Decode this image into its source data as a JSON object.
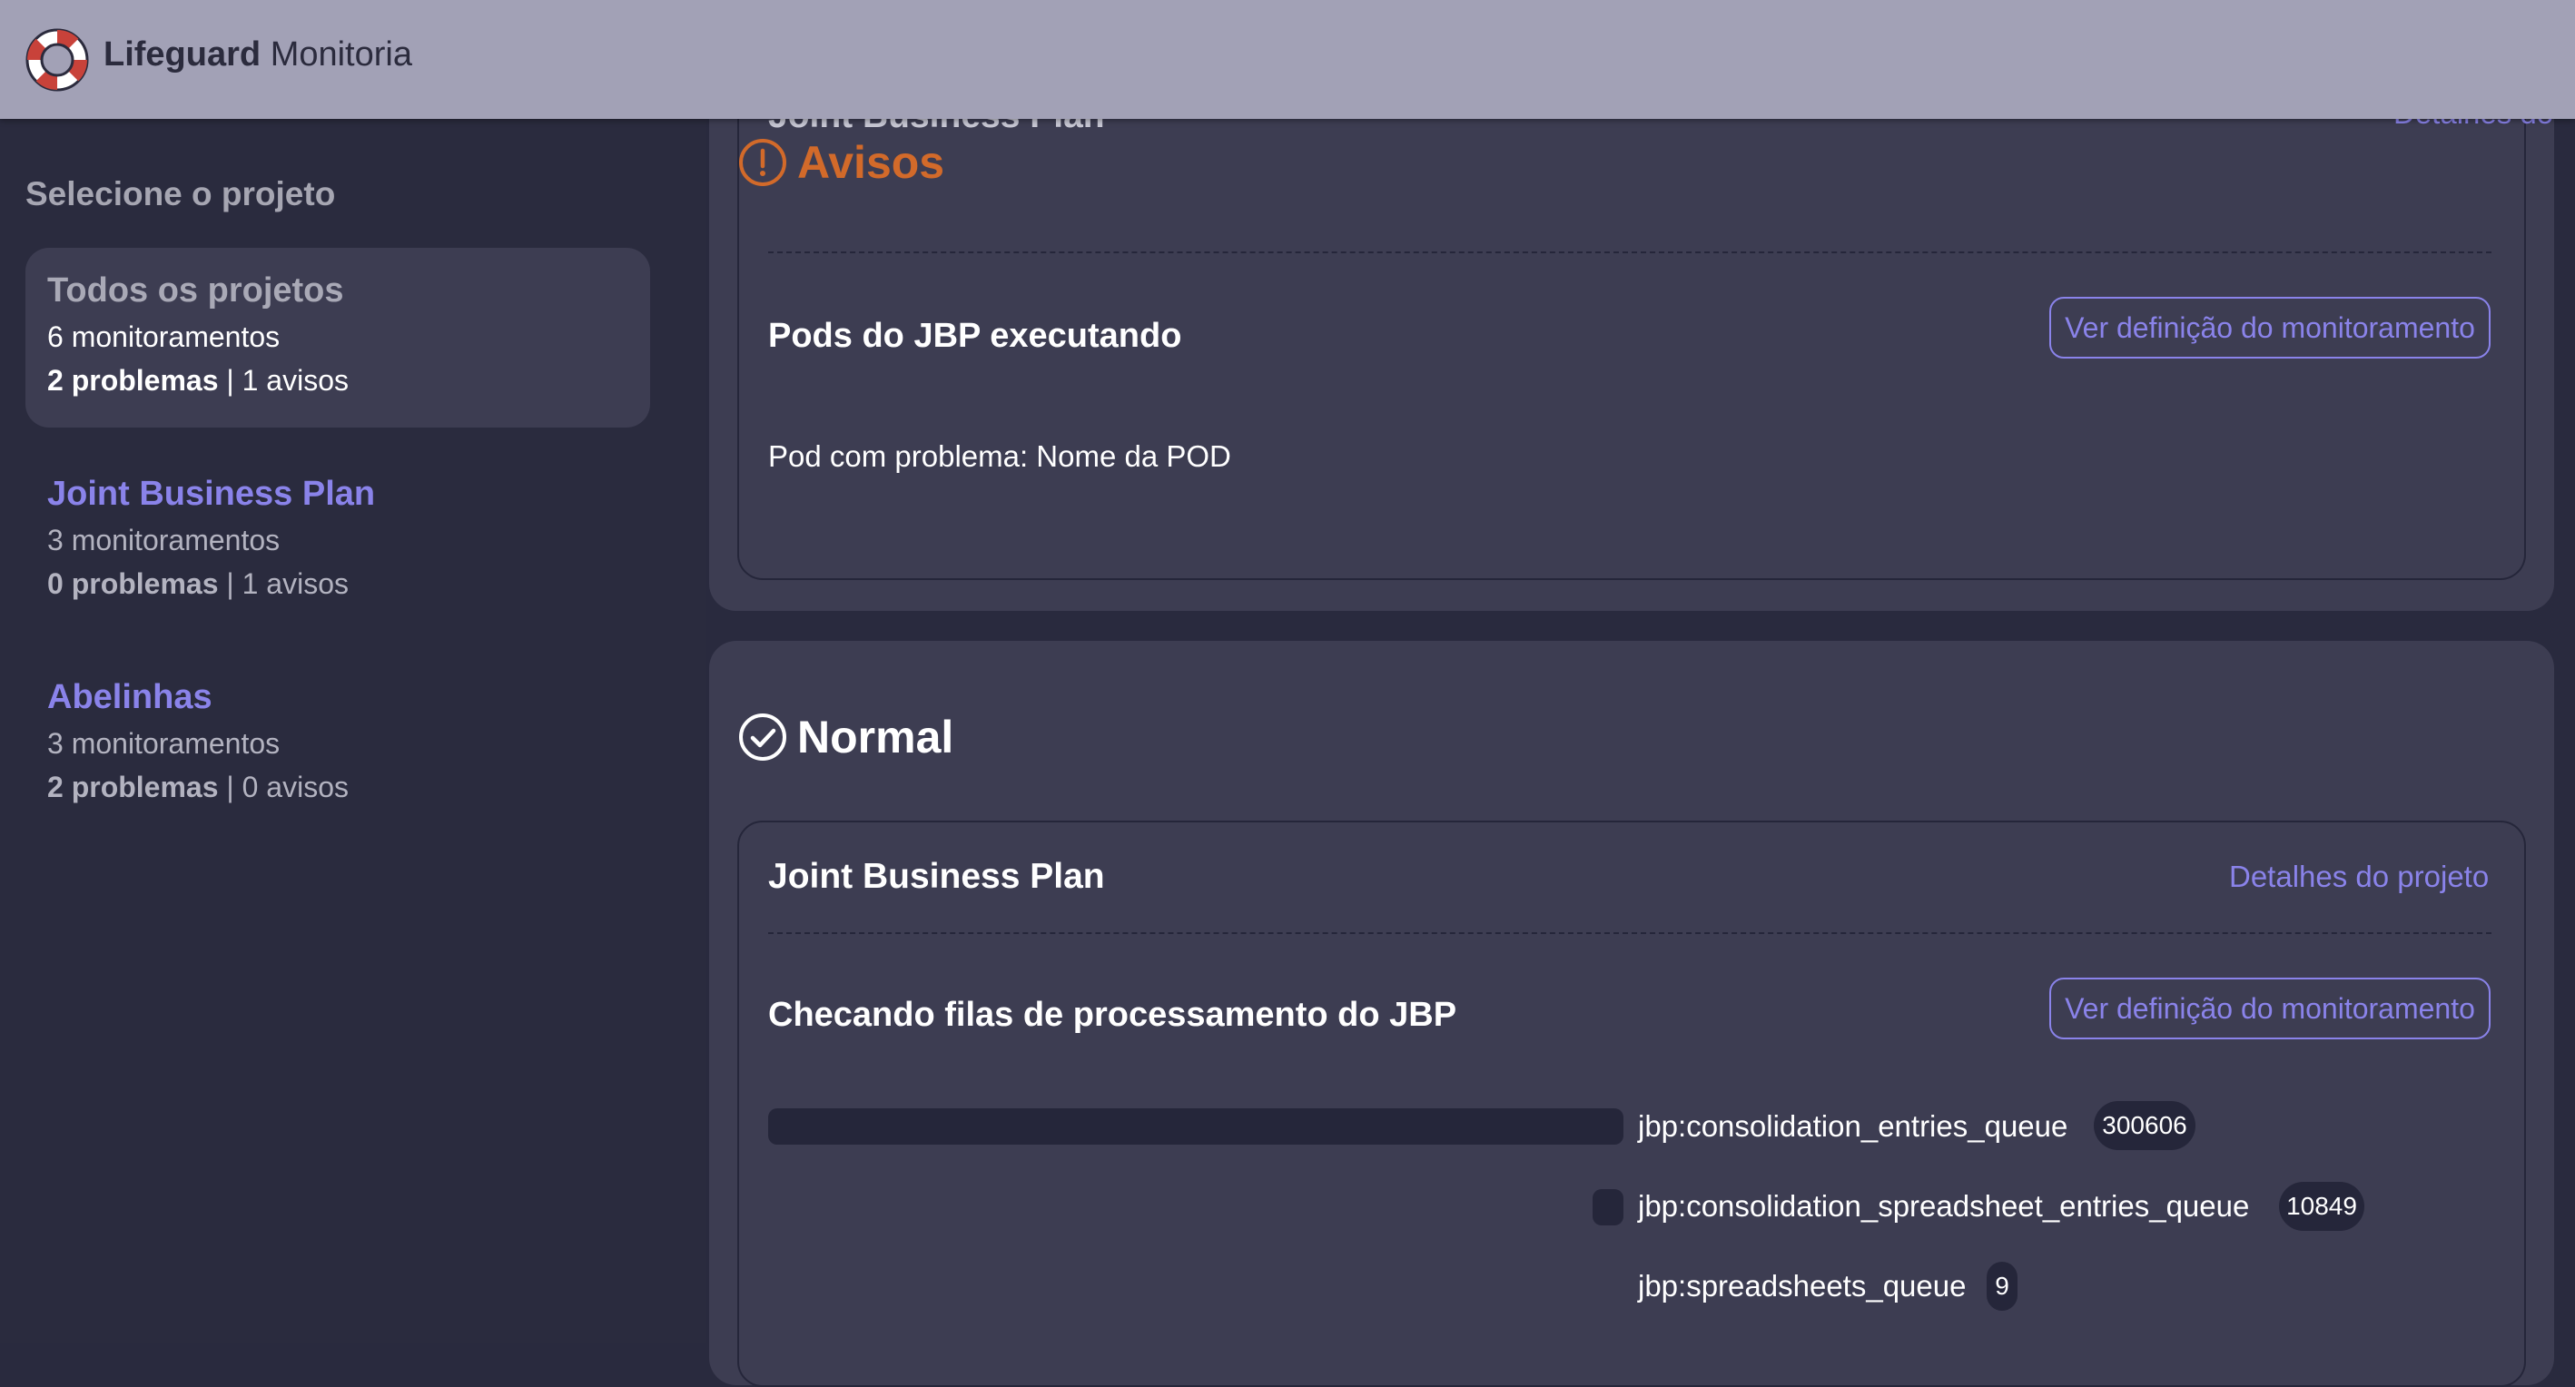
{
  "app": {
    "brand_bold": "Lifeguard",
    "brand_light": "Monitoria"
  },
  "sidebar": {
    "title": "Selecione o projeto",
    "projects": [
      {
        "name": "Todos os projetos",
        "monitors": "6 monitoramentos",
        "problems": "2 problemas",
        "separator": " | ",
        "warnings": "1 avisos",
        "active": true
      },
      {
        "name": "Joint Business Plan",
        "monitors": "3 monitoramentos",
        "problems": "0 problemas",
        "separator": " | ",
        "warnings": "1 avisos",
        "active": false
      },
      {
        "name": "Abelinhas",
        "monitors": "3 monitoramentos",
        "problems": "2 problemas",
        "separator": " | ",
        "warnings": "0 avisos",
        "active": false
      }
    ]
  },
  "warnings_section": {
    "title": "Avisos",
    "partial_project_name": "Joint Business Plan",
    "partial_link": "Detalhes do projeto",
    "monitor": {
      "title": "Pods do JBP executando",
      "button": "Ver definição do monitoramento",
      "message": "Pod com problema: Nome da POD"
    }
  },
  "normal_section": {
    "title": "Normal",
    "project": {
      "name": "Joint Business Plan",
      "details_link": "Detalhes do projeto",
      "monitor": {
        "title": "Checando filas de processamento do JBP",
        "button": "Ver definição do monitoramento",
        "queues": [
          {
            "name": "jbp:consolidation_entries_queue",
            "count": "300606",
            "value": 300606
          },
          {
            "name": "jbp:consolidation_spreadsheet_entries_queue",
            "count": "10849",
            "value": 10849
          },
          {
            "name": "jbp:spreadsheets_queue",
            "count": "9",
            "value": 9
          }
        ]
      }
    }
  },
  "colors": {
    "accent": "#8a83ea",
    "warning": "#d26a2a",
    "topbar": "#a2a1b6",
    "card": "#3d3d52",
    "background": "#292a3e"
  },
  "icons": {
    "logo": "lifebuoy-icon",
    "warning": "exclamation-circle-icon",
    "normal": "check-circle-icon"
  }
}
